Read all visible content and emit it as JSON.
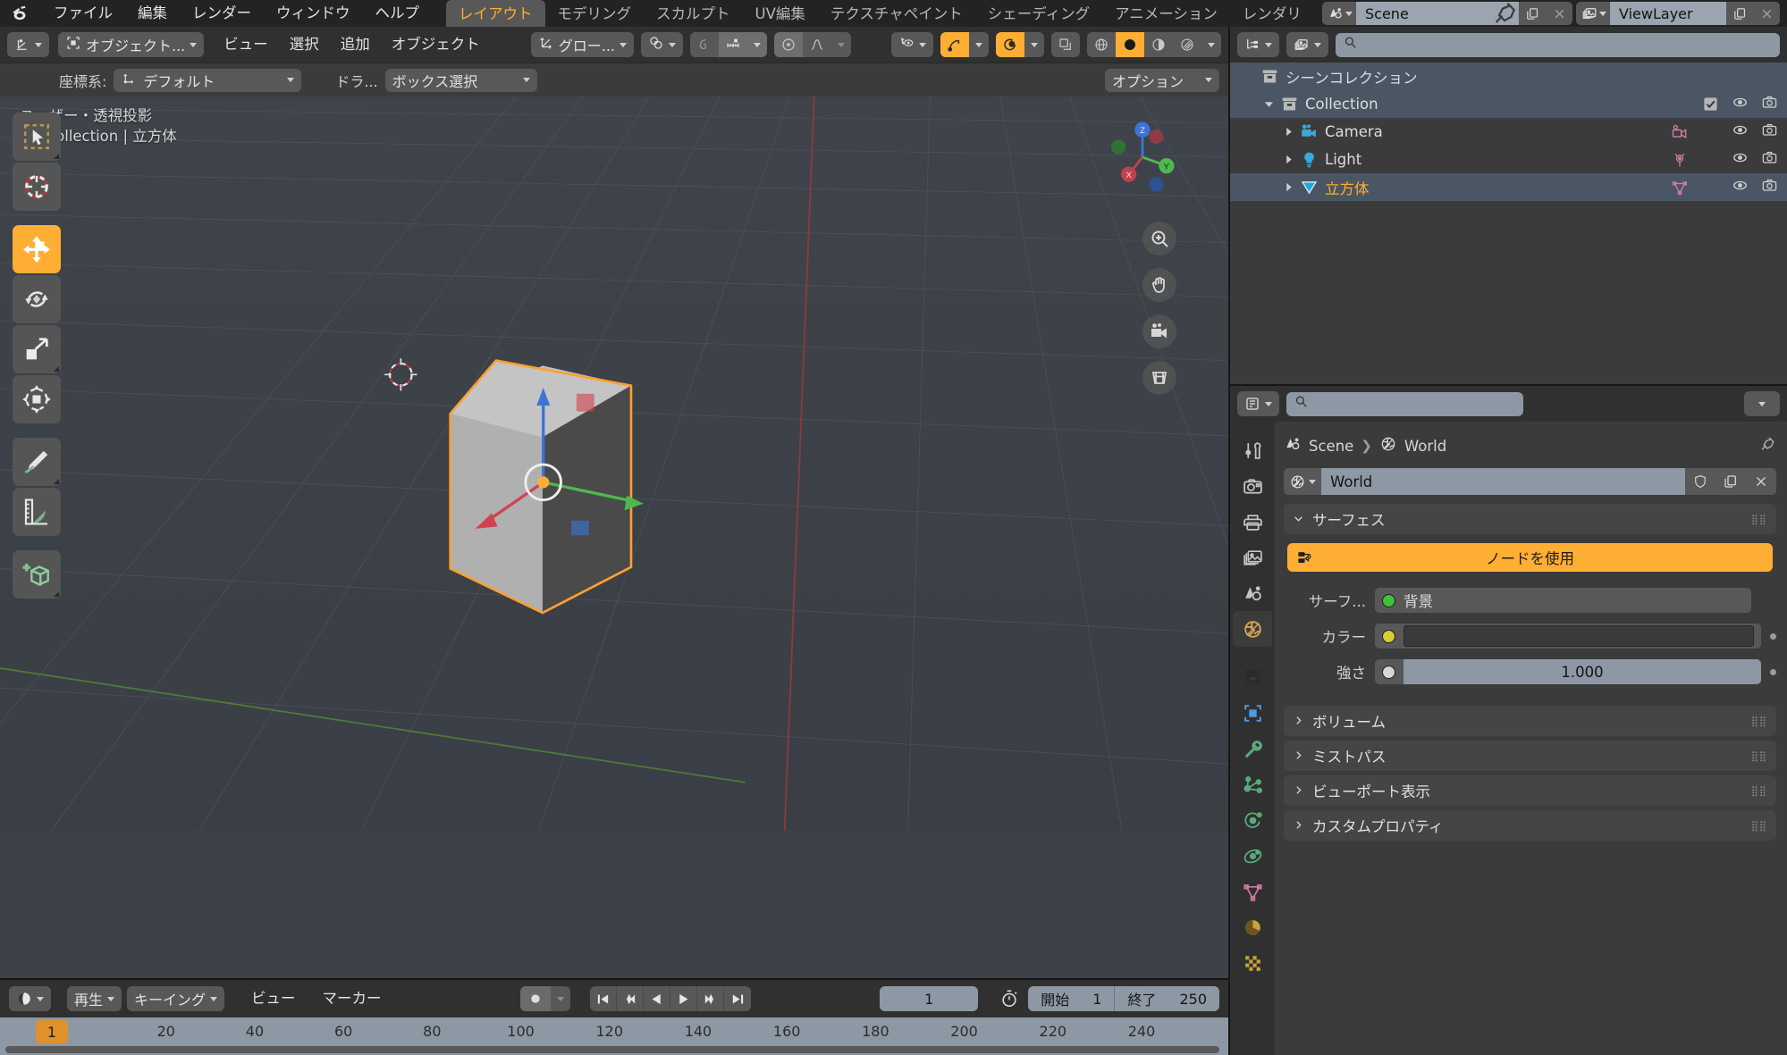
{
  "topbar": {
    "logo_icon": "blender-logo",
    "menus": [
      "ファイル",
      "編集",
      "レンダー",
      "ウィンドウ",
      "ヘルプ"
    ],
    "workspace_tabs": [
      {
        "label": "レイアウト",
        "active": true
      },
      {
        "label": "モデリング",
        "active": false
      },
      {
        "label": "スカルプト",
        "active": false
      },
      {
        "label": "UV編集",
        "active": false
      },
      {
        "label": "テクスチャペイント",
        "active": false
      },
      {
        "label": "シェーディング",
        "active": false
      },
      {
        "label": "アニメーション",
        "active": false
      },
      {
        "label": "レンダリ",
        "active": false
      }
    ],
    "scene_name": "Scene",
    "viewlayer_name": "ViewLayer",
    "scene_icon": "scene-icon",
    "viewlayer_icon": "viewlayer-icon",
    "pin_icon": "pin-icon",
    "new_icon": "duplicate-icon",
    "remove_icon": "close-icon"
  },
  "viewport_header": {
    "editor_type_icon": "editor-type-3dview-icon",
    "mode_icon": "object-mode-icon",
    "mode_label": "オブジェクト...",
    "menus": [
      "ビュー",
      "選択",
      "追加",
      "オブジェクト"
    ],
    "transform_orientation_label": "グロー...",
    "transform_orientation_icon": "orientation-icon",
    "snap_icon": "snap-magnet-icon",
    "proportional_icon": "proportional-edit-icon",
    "proportional_falloff_icon": "falloff-smooth-icon",
    "measure_icon": "measure-icon",
    "visibility_icon": "visibility-selectability-icon",
    "gizmo_icon": "gizmo-icon",
    "overlays_icon": "overlays-icon",
    "xray_icon": "xray-icon",
    "shading_modes": [
      {
        "name": "wireframe-shading-icon",
        "active": false
      },
      {
        "name": "solid-shading-icon",
        "active": true
      },
      {
        "name": "material-preview-shading-icon",
        "active": false
      },
      {
        "name": "rendered-shading-icon",
        "active": false
      }
    ]
  },
  "tool_settings": {
    "orientation_label": "座標系:",
    "orientation_value": "デフォルト",
    "orientation_icon": "orientation-default-icon",
    "drag_label": "ドラ...",
    "drag_value": "ボックス選択",
    "options_label": "オプション"
  },
  "viewport": {
    "overlay_line1": "ユーザー・透視投影",
    "overlay_line2": "(1) Collection | 立方体",
    "gizmo_axes": [
      {
        "label": "X",
        "color": "#cd3a4a"
      },
      {
        "label": "Y",
        "color": "#8cc63f"
      },
      {
        "label": "Z",
        "color": "#2a6ecc"
      }
    ],
    "nav_buttons": [
      "zoom-icon",
      "pan-hand-icon",
      "camera-view-icon",
      "toggle-ortho-perspective-icon"
    ],
    "tools": [
      {
        "name": "tweak-select-box-tool",
        "icon": "cursor-select-box-icon",
        "active": false,
        "has_sub": true
      },
      {
        "name": "cursor-tool",
        "icon": "3d-cursor-icon",
        "active": false,
        "has_sub": false
      },
      {
        "name": "move-tool",
        "icon": "move-arrows-icon",
        "active": true,
        "has_sub": false
      },
      {
        "name": "rotate-tool",
        "icon": "rotate-icon",
        "active": false,
        "has_sub": false
      },
      {
        "name": "scale-tool",
        "icon": "scale-icon",
        "active": false,
        "has_sub": true
      },
      {
        "name": "transform-tool",
        "icon": "transform-icon",
        "active": false,
        "has_sub": false
      },
      {
        "name": "annotate-tool",
        "icon": "pencil-annotate-icon",
        "active": false,
        "has_sub": true
      },
      {
        "name": "measure-tool",
        "icon": "ruler-measure-icon",
        "active": false,
        "has_sub": false
      },
      {
        "name": "add-cube-tool",
        "icon": "add-cube-icon",
        "active": false,
        "has_sub": true
      }
    ]
  },
  "timeline": {
    "editor_icon": "timeline-editor-icon",
    "playback_label": "再生",
    "keying_label": "キーイング",
    "menus": [
      "ビュー",
      "マーカー"
    ],
    "record_icon": "record-icon",
    "transport": [
      "jump-to-start-icon",
      "prev-keyframe-icon",
      "play-reverse-icon",
      "play-icon",
      "next-keyframe-icon",
      "jump-to-end-icon"
    ],
    "current_frame": "1",
    "use_preview_range_icon": "stopwatch-icon",
    "start_label": "開始",
    "start_value": "1",
    "end_label": "終了",
    "end_value": "250",
    "ticks": [
      "20",
      "40",
      "60",
      "80",
      "100",
      "120",
      "140",
      "160",
      "180",
      "200",
      "220",
      "240"
    ],
    "playhead_label": "1"
  },
  "outliner": {
    "display_mode_icon": "outliner-display-mode-icon",
    "filter_icon": "outliner-filter-icon",
    "search_placeholder": "",
    "search_icon": "search-icon",
    "rows": [
      {
        "name": "シーンコレクション",
        "icon": "scene-collection-icon",
        "indent": 0,
        "expand": "none",
        "selected": true,
        "active": false,
        "show_toggles": false,
        "data_icon": ""
      },
      {
        "name": "Collection",
        "icon": "collection-icon",
        "indent": 1,
        "expand": "open",
        "selected": true,
        "active": false,
        "show_toggles": true,
        "checkbox": true,
        "data_icon": ""
      },
      {
        "name": "Camera",
        "icon": "camera-object-icon",
        "indent": 2,
        "expand": "closed",
        "selected": false,
        "active": false,
        "show_toggles": true,
        "checkbox": false,
        "data_icon": "camera-data-icon"
      },
      {
        "name": "Light",
        "icon": "light-object-icon",
        "indent": 2,
        "expand": "closed",
        "selected": false,
        "active": false,
        "show_toggles": true,
        "checkbox": false,
        "data_icon": "light-data-icon"
      },
      {
        "name": "立方体",
        "icon": "mesh-object-icon",
        "indent": 2,
        "expand": "closed",
        "selected": true,
        "active": true,
        "show_toggles": true,
        "checkbox": false,
        "data_icon": "mesh-data-icon"
      }
    ],
    "toggle_icons": [
      "eye-icon",
      "camera-render-icon"
    ]
  },
  "properties": {
    "editor_icon": "properties-editor-icon",
    "search_placeholder": "",
    "search_icon": "search-icon",
    "options_icon": "chevron-down-icon",
    "breadcrumb": [
      {
        "label": "Scene",
        "icon": "scene-icon"
      },
      {
        "label": "World",
        "icon": "world-icon"
      }
    ],
    "pin_icon": "pin-icon",
    "id_block": {
      "browse_icon": "world-icon",
      "name": "World",
      "fake_user_icon": "shield-icon",
      "new_icon": "duplicate-icon",
      "unlink_icon": "close-icon"
    },
    "tabs": [
      {
        "name": "tool-tab",
        "icon": "tool-wrench-screwdriver-icon",
        "active": false,
        "color": "#c4c4c4"
      },
      {
        "name": "render-tab",
        "icon": "render-camera-back-icon",
        "active": false,
        "color": "#c4c4c4"
      },
      {
        "name": "output-tab",
        "icon": "output-printer-icon",
        "active": false,
        "color": "#c4c4c4"
      },
      {
        "name": "viewlayer-tab",
        "icon": "viewlayer-images-icon",
        "active": false,
        "color": "#c4c4c4"
      },
      {
        "name": "scene-tab",
        "icon": "scene-cone-icon",
        "active": false,
        "color": "#c4c4c4"
      },
      {
        "name": "world-tab",
        "icon": "world-globe-icon",
        "active": true,
        "color": "#d8a657"
      },
      {
        "name": "collection-tab",
        "icon": "collection-box-icon",
        "active": false,
        "color": "#2b2b2b"
      },
      {
        "name": "object-tab",
        "icon": "object-square-icon",
        "active": false,
        "color": "#4d9ee0"
      },
      {
        "name": "modifiers-tab",
        "icon": "wrench-icon",
        "active": false,
        "color": "#5aab7b"
      },
      {
        "name": "particles-tab",
        "icon": "particles-icon",
        "active": false,
        "color": "#5aab7b"
      },
      {
        "name": "physics-tab",
        "icon": "physics-orbit-icon",
        "active": false,
        "color": "#5aab7b"
      },
      {
        "name": "constraints-tab",
        "icon": "constraints-icon",
        "active": false,
        "color": "#5aab7b"
      },
      {
        "name": "data-tab",
        "icon": "mesh-data-triangle-icon",
        "active": false,
        "color": "#d07aa8"
      },
      {
        "name": "material-tab",
        "icon": "material-sphere-icon",
        "active": false,
        "color": "#c8a23c"
      },
      {
        "name": "texture-tab",
        "icon": "texture-checker-icon",
        "active": false,
        "color": "#c8a23c"
      }
    ],
    "surface_panel": {
      "title": "サーフェス",
      "use_nodes_label": "ノードを使用",
      "use_nodes_icon": "nodetree-icon",
      "rows": [
        {
          "label": "サーフ...",
          "value": "背景",
          "socket_color": "#3ec13e",
          "type": "enum"
        },
        {
          "label": "カラー",
          "value": "",
          "socket_color": "#d3cf34",
          "type": "color",
          "swatch": "#3a3a3a"
        },
        {
          "label": "強さ",
          "value": "1.000",
          "socket_color": "#d6d6d6",
          "type": "number"
        }
      ]
    },
    "closed_panels": [
      "ボリューム",
      "ミストパス",
      "ビューポート表示",
      "カスタムプロパティ"
    ]
  },
  "colors": {
    "accent_orange": "#ffae34",
    "panel_bg": "#3b3b3b",
    "header_bg": "#303030",
    "viewport_bg": "#3d4148",
    "field_light": "#8d98a4",
    "field_dark": "#585858"
  }
}
